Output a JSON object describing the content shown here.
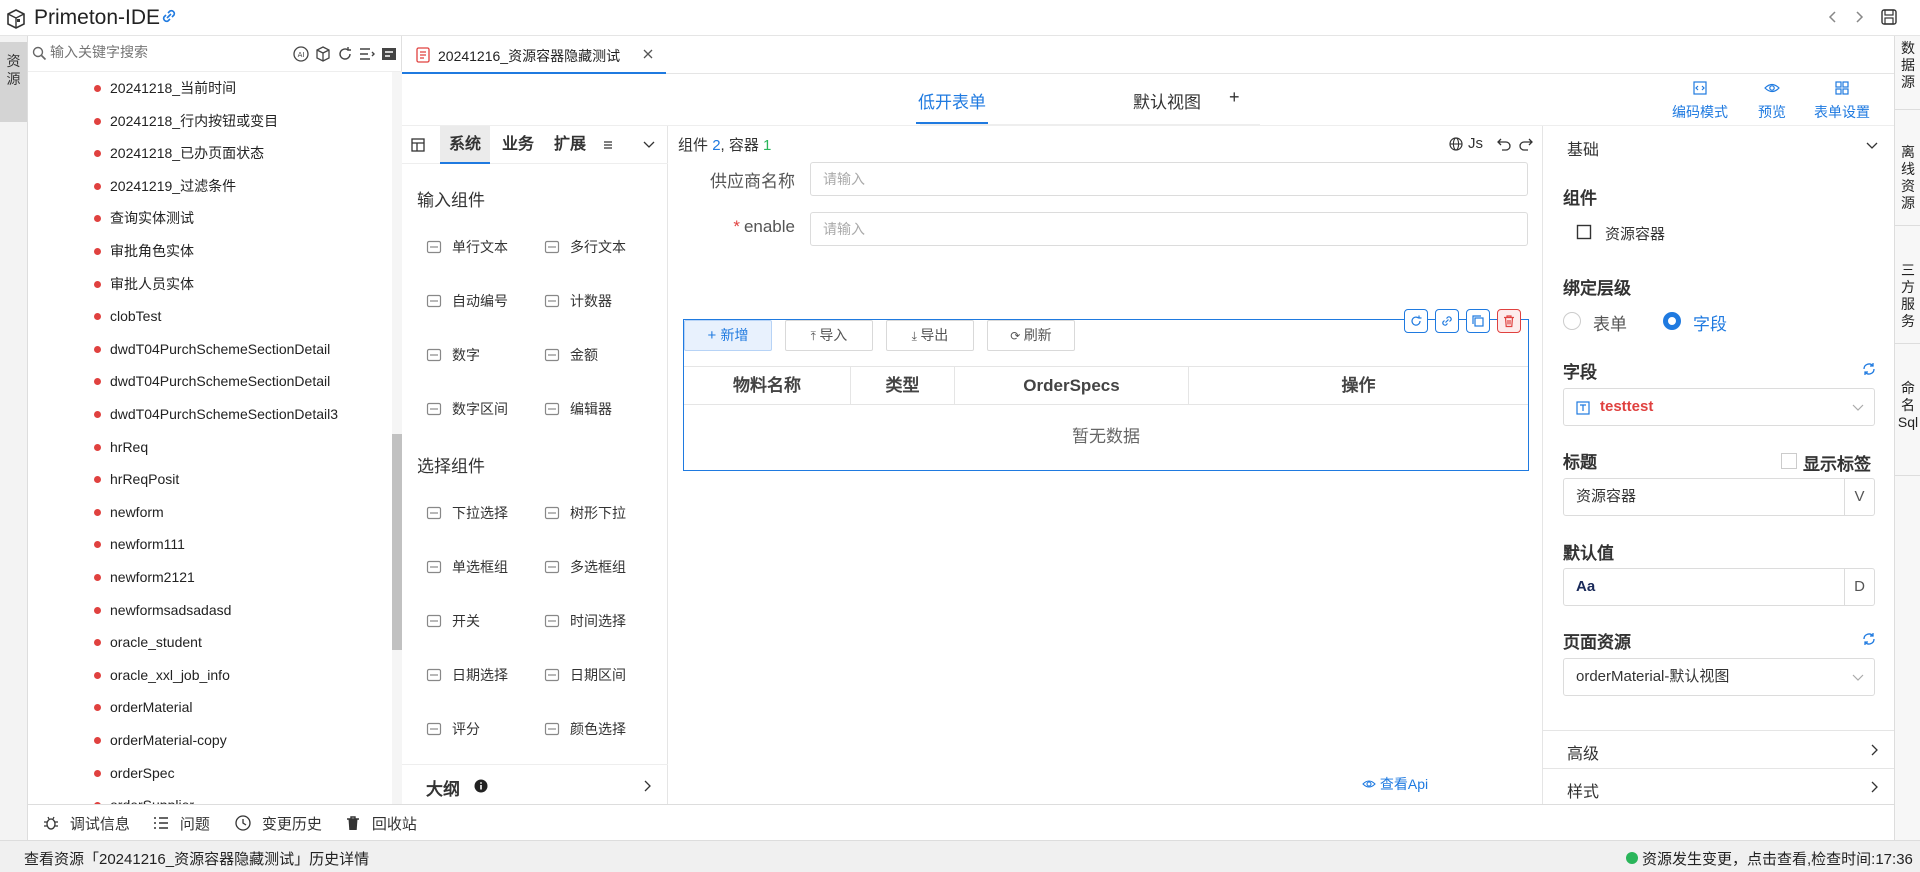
{
  "app": {
    "title": "Primeton-IDE"
  },
  "left_rail": {
    "label": "资源"
  },
  "search": {
    "placeholder": "输入关键字搜索"
  },
  "tree": {
    "items": [
      "20241218_当前时间",
      "20241218_行内按钮或变目",
      "20241218_已办页面状态",
      "20241219_过滤条件",
      "查询实体测试",
      "审批角色实体",
      "审批人员实体",
      "clobTest",
      "dwdT04PurchSchemeSectionDetail",
      "dwdT04PurchSchemeSectionDetail",
      "dwdT04PurchSchemeSectionDetail3",
      "hrReq",
      "hrReqPosit",
      "newform",
      "newform111",
      "newform2121",
      "newformsadsadasd",
      "oracle_student",
      "oracle_xxl_job_info",
      "orderMaterial",
      "orderMaterial-copy",
      "orderSpec",
      "orderSupplier"
    ]
  },
  "editor_tab": {
    "label": "20241216_资源容器隐藏测试"
  },
  "view_tabs": {
    "low_code": "低开表单",
    "default_view": "默认视图",
    "add": "+"
  },
  "toolbar_right": {
    "code_mode": "编码模式",
    "preview": "预览",
    "form_settings": "表单设置"
  },
  "palette": {
    "tabs": [
      "系统",
      "业务",
      "扩展"
    ],
    "section_input": "输入组件",
    "section_select": "选择组件",
    "input_items": [
      "单行文本",
      "多行文本",
      "自动编号",
      "计数器",
      "数字",
      "金额",
      "数字区间",
      "编辑器"
    ],
    "select_items": [
      "下拉选择",
      "树形下拉",
      "单选框组",
      "多选框组",
      "开关",
      "时间选择",
      "日期选择",
      "日期区间",
      "评分",
      "颜色选择"
    ],
    "outline": "大纲"
  },
  "canvas": {
    "stats_prefix": "组件",
    "component_count": "2",
    "stats_mid": ", 容器",
    "container_count": "1",
    "js_label": "Js",
    "fields": [
      {
        "label": "供应商名称",
        "placeholder": "请输入",
        "required": false
      },
      {
        "label": "enable",
        "placeholder": "请输入",
        "required": true
      }
    ],
    "required_mark": "*",
    "buttons": {
      "add": "新增",
      "import": "导入",
      "export": "导出",
      "refresh": "刷新"
    },
    "table_headers": [
      "物料名称",
      "类型",
      "OrderSpecs",
      "操作"
    ],
    "empty_text": "暂无数据",
    "view_api": "查看Api"
  },
  "props": {
    "basic": "基础",
    "component_heading": "组件",
    "component_name": "资源容器",
    "bind_level_heading": "绑定层级",
    "bind_options": [
      "表单",
      "字段"
    ],
    "bind_selected": "字段",
    "field_heading": "字段",
    "field_value": "testtest",
    "title_heading": "标题",
    "show_label": "显示标签",
    "title_value": "资源容器",
    "title_suffix": "V",
    "default_heading": "默认值",
    "default_value": "Aa",
    "default_suffix": "D",
    "page_resource_heading": "页面资源",
    "page_resource_value": "orderMaterial-默认视图",
    "advanced": "高级",
    "style": "样式"
  },
  "right_rail": [
    "数据源",
    "离线资源",
    "三方服务",
    "命名Sql"
  ],
  "debug_bar": [
    "调试信息",
    "问题",
    "变更历史",
    "回收站"
  ],
  "status": {
    "left": "查看资源「20241216_资源容器隐藏测试」历史详情",
    "right": "资源发生变更，点击查看,检查时间:17:36"
  },
  "colors": {
    "accent": "#1f7ae0",
    "danger": "#e0413f",
    "success": "#2ab55a"
  }
}
